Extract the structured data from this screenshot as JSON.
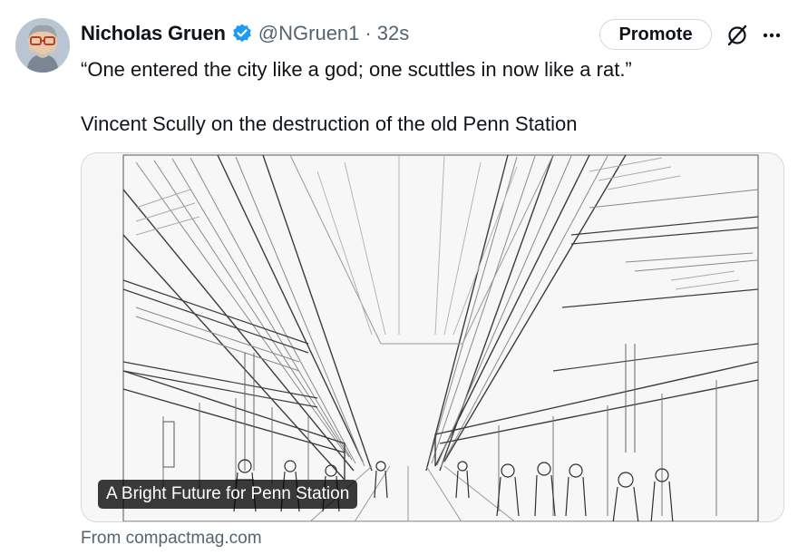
{
  "author": {
    "name": "Nicholas Gruen",
    "handle": "@NGruen1",
    "separator": "·",
    "timestamp": "32s",
    "verified_icon": "verified-badge-icon",
    "avatar_icon": "avatar-illustration"
  },
  "actions": {
    "promote_label": "Promote",
    "grok_icon": "grok-icon",
    "more_icon": "more-horizontal-icon"
  },
  "tweet": {
    "line1": "“One entered the city like a god; one scuttles in now like a rat.”",
    "line2": "Vincent Scully on the destruction of the old Penn Station"
  },
  "card": {
    "title": "A Bright Future for Penn Station",
    "source": "From compactmag.com",
    "image": "pencil-sketch-train-station-interior"
  },
  "colors": {
    "text": "#0f1419",
    "secondary": "#536471",
    "verified": "#1d9bf0",
    "border": "#cfd9de"
  }
}
